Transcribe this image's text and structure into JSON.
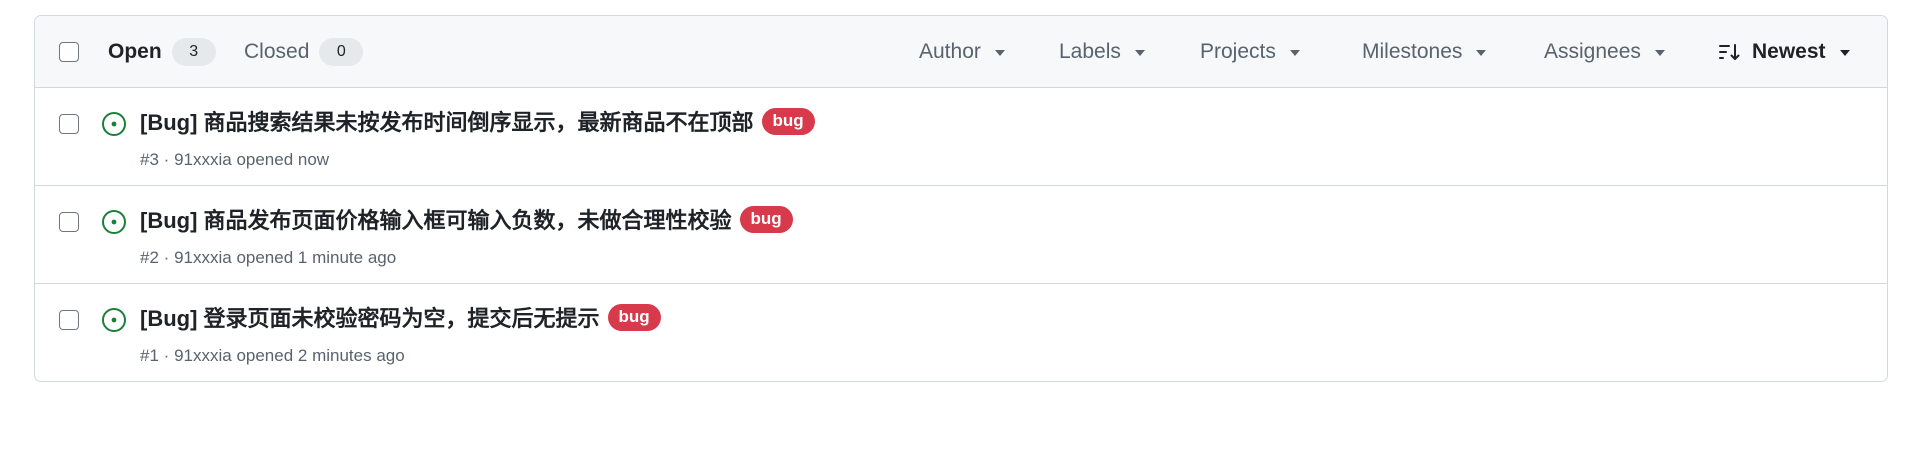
{
  "header": {
    "open_label": "Open",
    "open_count": "3",
    "closed_label": "Closed",
    "closed_count": "0",
    "filters": {
      "author": "Author",
      "labels": "Labels",
      "projects": "Projects",
      "milestones": "Milestones",
      "assignees": "Assignees",
      "sort": "Newest"
    }
  },
  "colors": {
    "open_icon": "#1a7f37",
    "bug_label": "#d73a4a"
  },
  "icons": {
    "open_issue": "issue-opened-icon",
    "sort": "sort-desc-icon",
    "dropdown": "triangle-down-icon"
  },
  "issues": [
    {
      "title": "[Bug] 商品搜索结果未按发布时间倒序显示，最新商品不在顶部",
      "label": "bug",
      "number": "#3",
      "separator": "·",
      "author": "91xxxia",
      "opened": "opened now"
    },
    {
      "title": "[Bug] 商品发布页面价格输入框可输入负数，未做合理性校验",
      "label": "bug",
      "number": "#2",
      "separator": "·",
      "author": "91xxxia",
      "opened": "opened 1 minute ago"
    },
    {
      "title": "[Bug] 登录页面未校验密码为空，提交后无提示",
      "label": "bug",
      "number": "#1",
      "separator": "·",
      "author": "91xxxia",
      "opened": "opened 2 minutes ago"
    }
  ]
}
